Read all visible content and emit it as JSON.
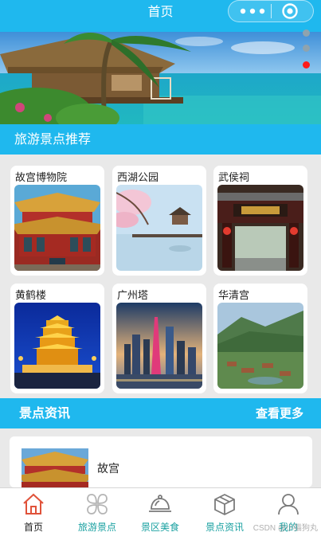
{
  "navbar": {
    "title": "首页",
    "more_icon": "ellipsis-icon",
    "close_icon": "target-close-icon"
  },
  "banner": {
    "pages": 3,
    "active_index": 2
  },
  "recommend": {
    "title": "旅游景点推荐",
    "spots": [
      {
        "label": "故宫博物院"
      },
      {
        "label": "西湖公园"
      },
      {
        "label": "武侯祠"
      },
      {
        "label": "黄鹤楼"
      },
      {
        "label": "广州塔"
      },
      {
        "label": "华清宫"
      }
    ]
  },
  "news": {
    "title": "景点资讯",
    "more_label": "查看更多",
    "items": [
      {
        "title": "故宫"
      }
    ]
  },
  "tabbar": {
    "items": [
      {
        "label": "首页",
        "icon": "home-icon",
        "color": "#222222"
      },
      {
        "label": "旅游景点",
        "icon": "clover-icon",
        "color": "#1aa1a1"
      },
      {
        "label": "景区美食",
        "icon": "cloche-icon",
        "color": "#1aa1a1"
      },
      {
        "label": "景点资讯",
        "icon": "cube-icon",
        "color": "#1aa1a1"
      },
      {
        "label": "我的",
        "icon": "user-icon",
        "color": "#1aa1a1"
      }
    ]
  },
  "watermark": "CSDN @小猫狗丸",
  "colors": {
    "accent": "#1fb8ee",
    "dot_active": "#ff1a1a",
    "tab_active": "#222222",
    "tab_inactive": "#1aa1a1"
  }
}
